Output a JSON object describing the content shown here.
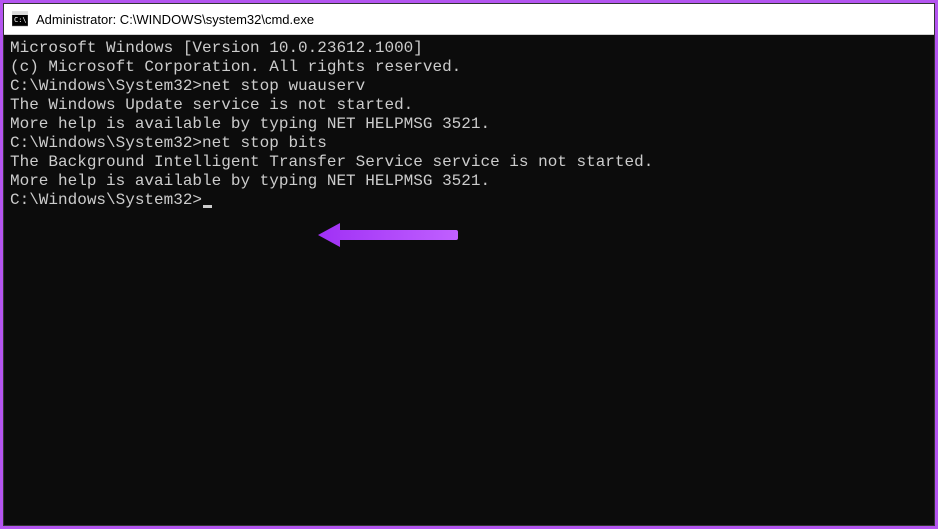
{
  "titlebar": {
    "title": "Administrator: C:\\WINDOWS\\system32\\cmd.exe"
  },
  "terminal": {
    "lines": [
      "Microsoft Windows [Version 10.0.23612.1000]",
      "(c) Microsoft Corporation. All rights reserved.",
      "",
      "C:\\Windows\\System32>net stop wuauserv",
      "The Windows Update service is not started.",
      "",
      "More help is available by typing NET HELPMSG 3521.",
      "",
      "",
      "C:\\Windows\\System32>net stop bits",
      "The Background Intelligent Transfer Service service is not started.",
      "",
      "More help is available by typing NET HELPMSG 3521.",
      "",
      "",
      "C:\\Windows\\System32>"
    ]
  },
  "annotation": {
    "color": "#a030f5"
  }
}
